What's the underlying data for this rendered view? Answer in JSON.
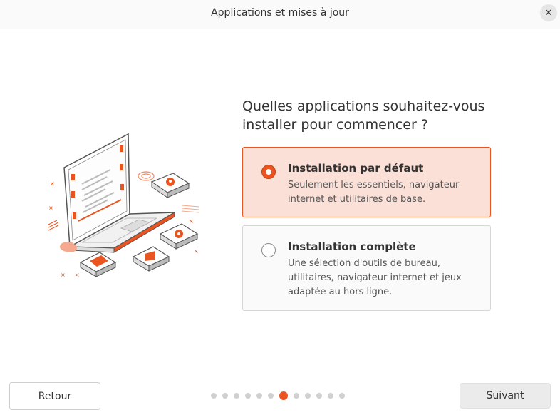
{
  "window": {
    "title": "Applications et mises à jour",
    "close_icon": "✕"
  },
  "main": {
    "question": "Quelles applications souhaitez-vous installer pour commencer ?",
    "options": [
      {
        "title": "Installation par défaut",
        "description": "Seulement les essentiels, navigateur\ninternet et utilitaires de base.",
        "selected": true
      },
      {
        "title": "Installation complète",
        "description": "Une sélection d'outils de bureau,\nutilitaires, navigateur internet et jeux\nadaptée au hors ligne.",
        "selected": false
      }
    ]
  },
  "footer": {
    "back_label": "Retour",
    "next_label": "Suivant",
    "steps_total": 12,
    "current_step": 7
  },
  "colors": {
    "accent": "#e95420",
    "selected_bg": "#fbe0d8"
  }
}
